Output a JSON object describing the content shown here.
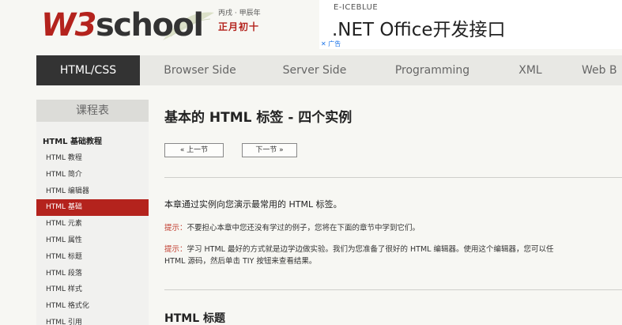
{
  "logo": {
    "w3": "W3",
    "school": "school"
  },
  "date": {
    "line1": "丙戌 · 甲辰年",
    "line2": "正月初十"
  },
  "ad": {
    "brand": "E-ICEBLUE",
    "title": ".NET Office开发接口",
    "badge": "✕ 广告"
  },
  "nav": {
    "items": [
      "HTML/CSS",
      "Browser Side",
      "Server Side",
      "Programming",
      "XML",
      "Web B"
    ]
  },
  "sidebar": {
    "heading": "课程表",
    "section": "HTML 基础教程",
    "items": [
      "HTML 教程",
      "HTML 简介",
      "HTML 编辑器",
      "HTML 基础",
      "HTML 元素",
      "HTML 属性",
      "HTML 标题",
      "HTML 段落",
      "HTML 样式",
      "HTML 格式化",
      "HTML 引用"
    ],
    "active_index": 3
  },
  "content": {
    "title": "基本的 HTML 标签 - 四个实例",
    "prev": "« 上一节",
    "next": "下一节 »",
    "intro": "本章通过实例向您演示最常用的 HTML 标签。",
    "tip1_label": "提示：",
    "tip1_text": "不要担心本章中您还没有学过的例子，您将在下面的章节中学到它们。",
    "tip2_label": "提示：",
    "tip2_text": "学习 HTML 最好的方式就是边学边做实验。我们为您准备了很好的 HTML 编辑器。使用这个编辑器，您可以任",
    "tip2_line2": "HTML 源码，然后单击 TIY 按钮来查看结果。",
    "section_heading": "HTML 标题"
  },
  "colors": {
    "brand_red": "#b4231d",
    "nav_active": "#333333"
  }
}
